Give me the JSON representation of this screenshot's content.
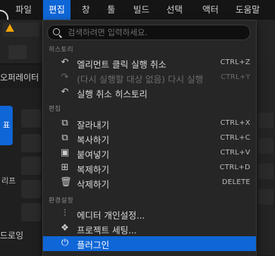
{
  "menubar": {
    "items": [
      "파일",
      "편집",
      "창",
      "툴",
      "빌드",
      "선택",
      "액터",
      "도움말"
    ]
  },
  "background": {
    "left_tab": "오퍼레이터",
    "blue_tab": "표",
    "side_label": "리프",
    "bottom_label": "드로잉"
  },
  "menu": {
    "search_placeholder": "검색하려면 입력하세요.",
    "sections": {
      "history": "히스토리",
      "edit": "편집",
      "settings": "환경설정"
    },
    "history_items": [
      {
        "label": "엘리먼트 클릭 실행 취소",
        "shortcut": "CTRL+Z",
        "icon": "undo-icon"
      },
      {
        "label": "(다시 실행할 대상 없음) 다시 실행",
        "shortcut": "CTRL+Y",
        "icon": "redo-icon"
      },
      {
        "label": "실행 취소 히스토리",
        "shortcut": "",
        "icon": "history-icon"
      }
    ],
    "edit_items": [
      {
        "label": "잘라내기",
        "shortcut": "CTRL+X",
        "icon": "cut-icon"
      },
      {
        "label": "복사하기",
        "shortcut": "CTRL+C",
        "icon": "copy-icon"
      },
      {
        "label": "붙여넣기",
        "shortcut": "CTRL+V",
        "icon": "paste-icon"
      },
      {
        "label": "복제하기",
        "shortcut": "CTRL+D",
        "icon": "duplicate-icon"
      },
      {
        "label": "삭제하기",
        "shortcut": "DELETE",
        "icon": "trash-icon"
      }
    ],
    "settings_items": [
      {
        "label": "에디터 개인설정...",
        "icon": "sliders-icon"
      },
      {
        "label": "프로젝트 세팅...",
        "icon": "project-icon"
      },
      {
        "label": "플러그인",
        "icon": "plugin-icon"
      }
    ]
  }
}
